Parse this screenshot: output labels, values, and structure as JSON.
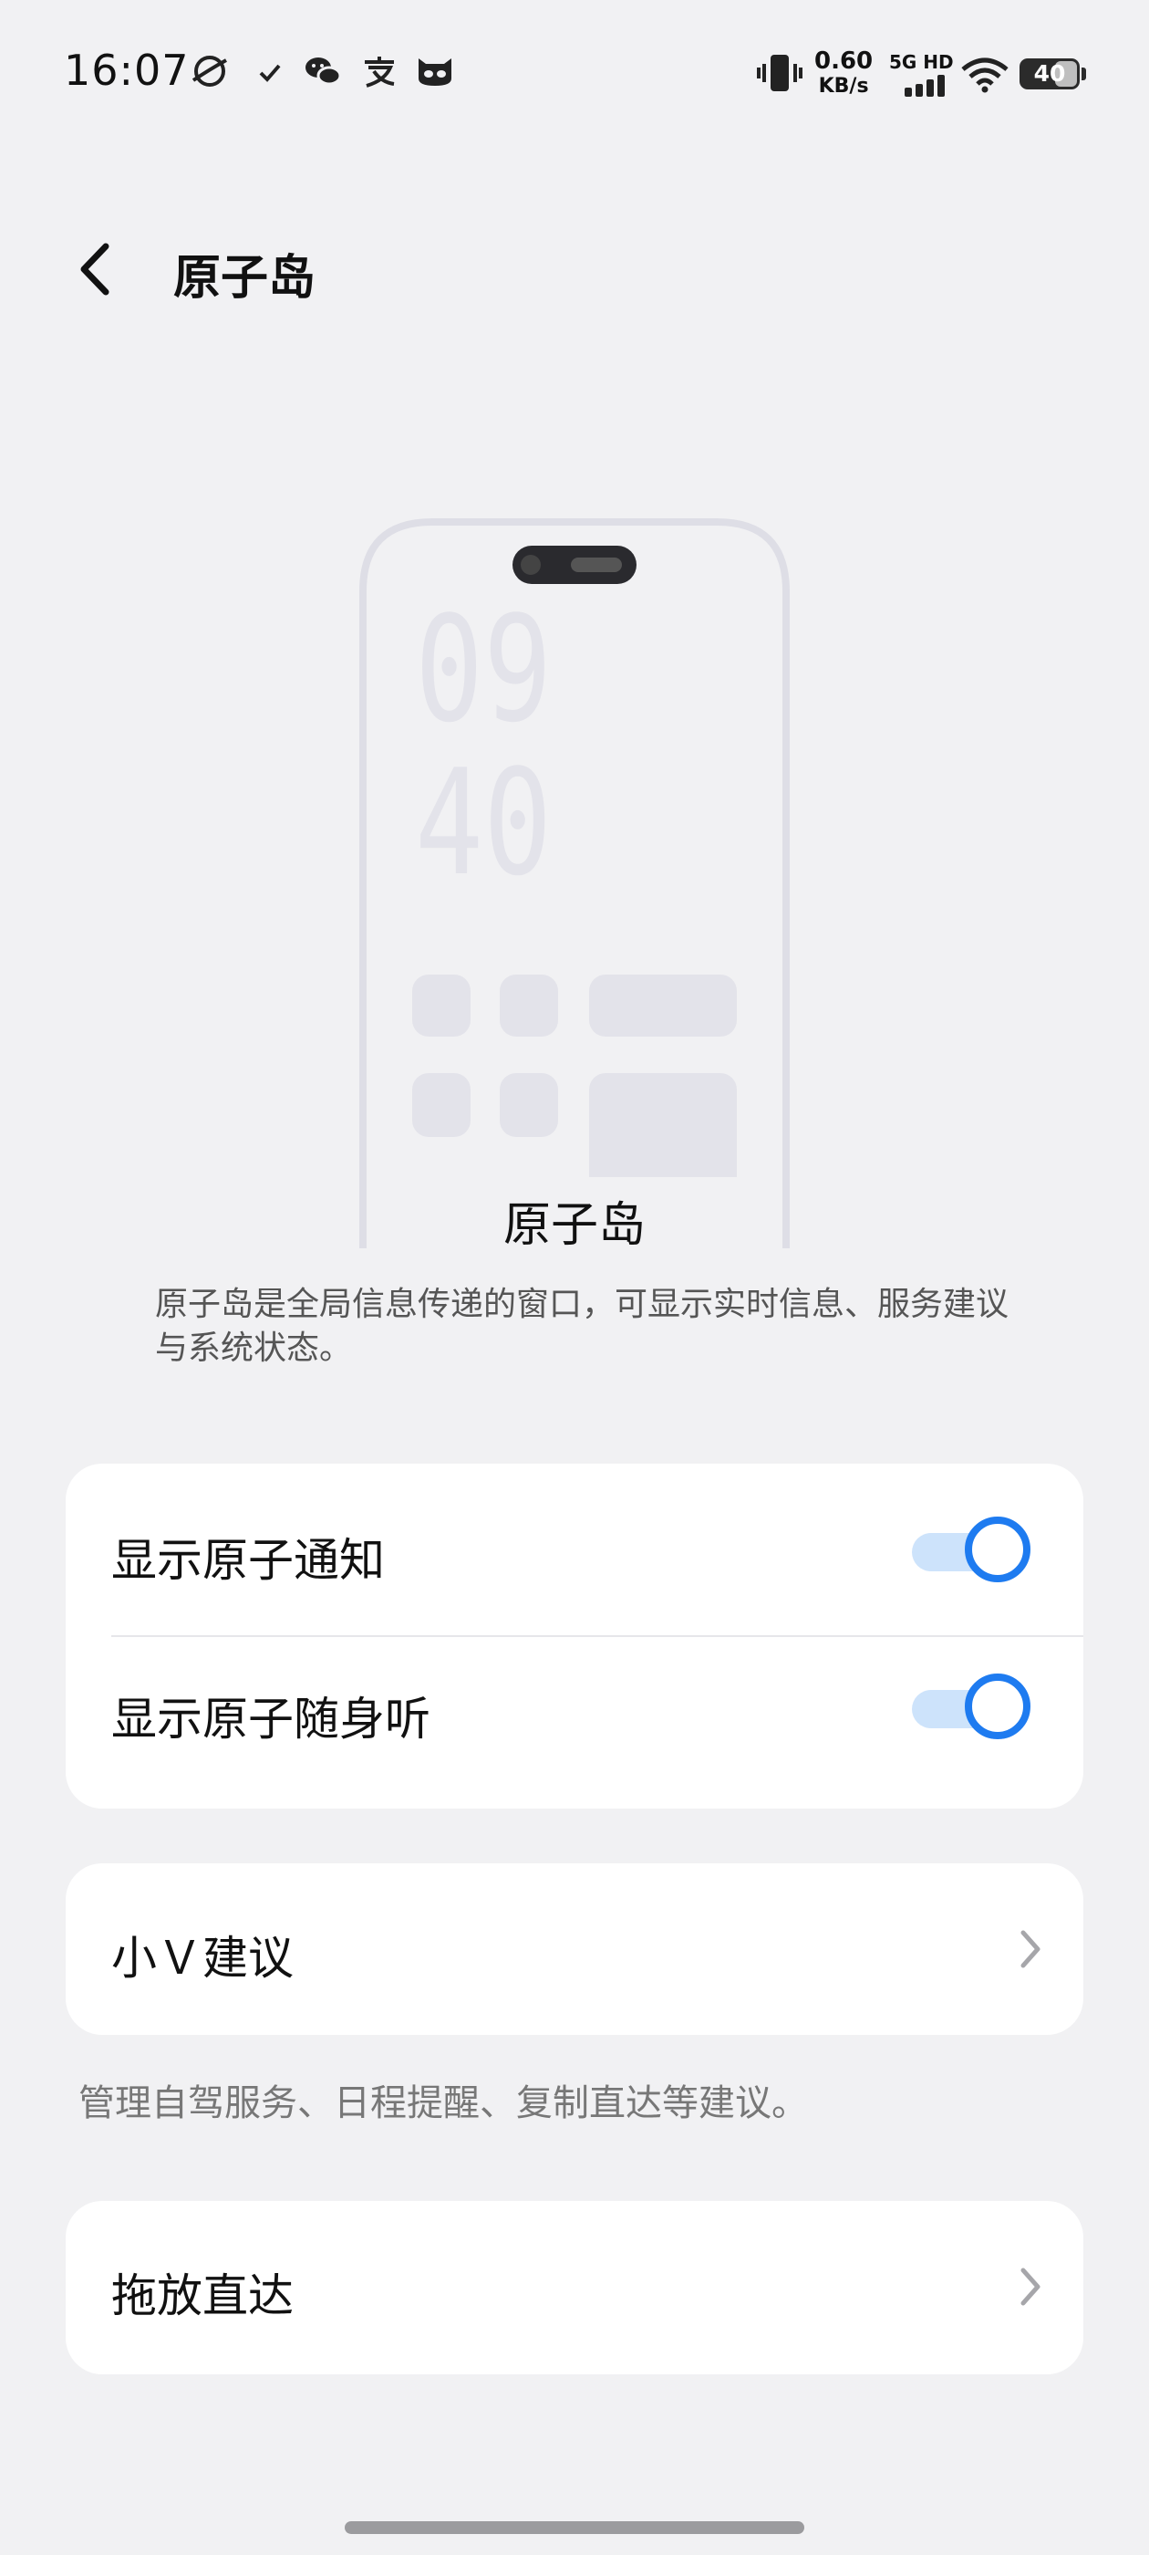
{
  "status_bar": {
    "time": "16:07",
    "speed_value": "0.60",
    "speed_unit": "KB/s",
    "network_label": "5G HD",
    "battery_level": "40"
  },
  "header": {
    "title": "原子岛"
  },
  "illustration": {
    "clock_hour": "09",
    "clock_minute": "40"
  },
  "feature": {
    "title": "原子岛",
    "description": "原子岛是全局信息传递的窗口，可显示实时信息、服务建议与系统状态。"
  },
  "settings_group": {
    "items": [
      {
        "label": "显示原子通知",
        "enabled": true
      },
      {
        "label": "显示原子随身听",
        "enabled": true
      }
    ]
  },
  "suggestions": {
    "label": "小Ｖ建议",
    "hint": "管理自驾服务、日程提醒、复制直达等建议。"
  },
  "drag_drop": {
    "label": "拖放直达"
  },
  "icons": [
    "planet-icon",
    "check-icon",
    "wechat-icon",
    "alipay-icon",
    "cat-icon",
    "vibrate-icon",
    "signal-icon",
    "wifi-icon",
    "battery-icon",
    "back-icon",
    "chevron-right-icon"
  ],
  "colors": {
    "accent": "#1e7bf0",
    "background": "#f1f1f3",
    "card": "#ffffff"
  }
}
